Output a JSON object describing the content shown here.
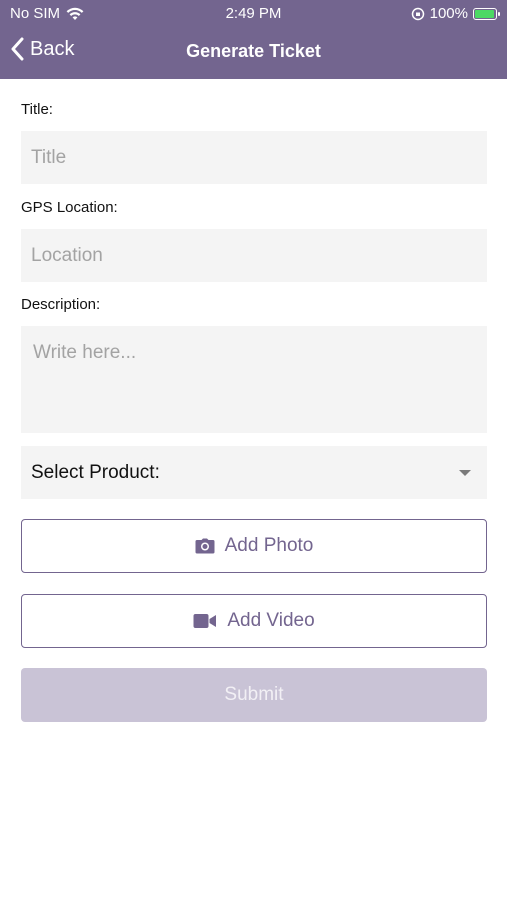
{
  "status_bar": {
    "carrier": "No SIM",
    "time": "2:49 PM",
    "battery_percent": "100%",
    "icons": [
      "wifi-icon",
      "orientation-lock-icon",
      "battery-charging-icon"
    ]
  },
  "nav": {
    "back_label": "Back",
    "title": "Generate Ticket"
  },
  "form": {
    "title_label": "Title:",
    "title_placeholder": "Title",
    "gps_label": "GPS Location:",
    "gps_placeholder": "Location",
    "description_label": "Description:",
    "description_placeholder": "Write here...",
    "product_select_label": "Select Product:",
    "add_photo_label": "Add Photo",
    "add_video_label": "Add Video",
    "submit_label": "Submit"
  },
  "colors": {
    "header_bg": "#73658f",
    "accent": "#73658f",
    "submit_disabled_bg": "#c9c3d6",
    "field_bg": "#f4f4f4"
  }
}
